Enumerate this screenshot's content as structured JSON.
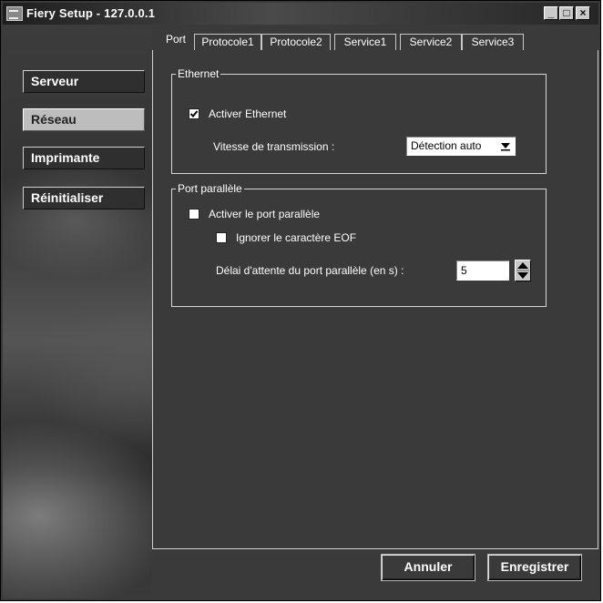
{
  "window": {
    "title": "Fiery Setup - 127.0.0.1"
  },
  "titlebar_buttons": {
    "minimize": "_",
    "maximize": "□",
    "close": "×"
  },
  "sidebar": {
    "items": [
      {
        "label": "Serveur"
      },
      {
        "label": "Réseau"
      },
      {
        "label": "Imprimante"
      },
      {
        "label": "Réinitialiser"
      }
    ],
    "active": "Réseau"
  },
  "tabs": [
    {
      "label": "Port"
    },
    {
      "label": "Protocole1"
    },
    {
      "label": "Protocole2"
    },
    {
      "label": "Service1"
    },
    {
      "label": "Service2"
    },
    {
      "label": "Service3"
    }
  ],
  "active_tab": "Port",
  "ethernet": {
    "title": "Ethernet",
    "enable_label": "Activer Ethernet",
    "enable_checked": true,
    "speed_label": "Vitesse de transmission :",
    "speed_value": "Détection auto"
  },
  "parallel": {
    "title": "Port parallèle",
    "enable_label": "Activer le port parallèle",
    "enable_checked": false,
    "ignore_eof_label": "Ignorer le caractère EOF",
    "ignore_eof_checked": false,
    "timeout_label": "Délai d'attente du port parallèle (en s) :",
    "timeout_value": "5"
  },
  "buttons": {
    "cancel": "Annuler",
    "save": "Enregistrer"
  }
}
